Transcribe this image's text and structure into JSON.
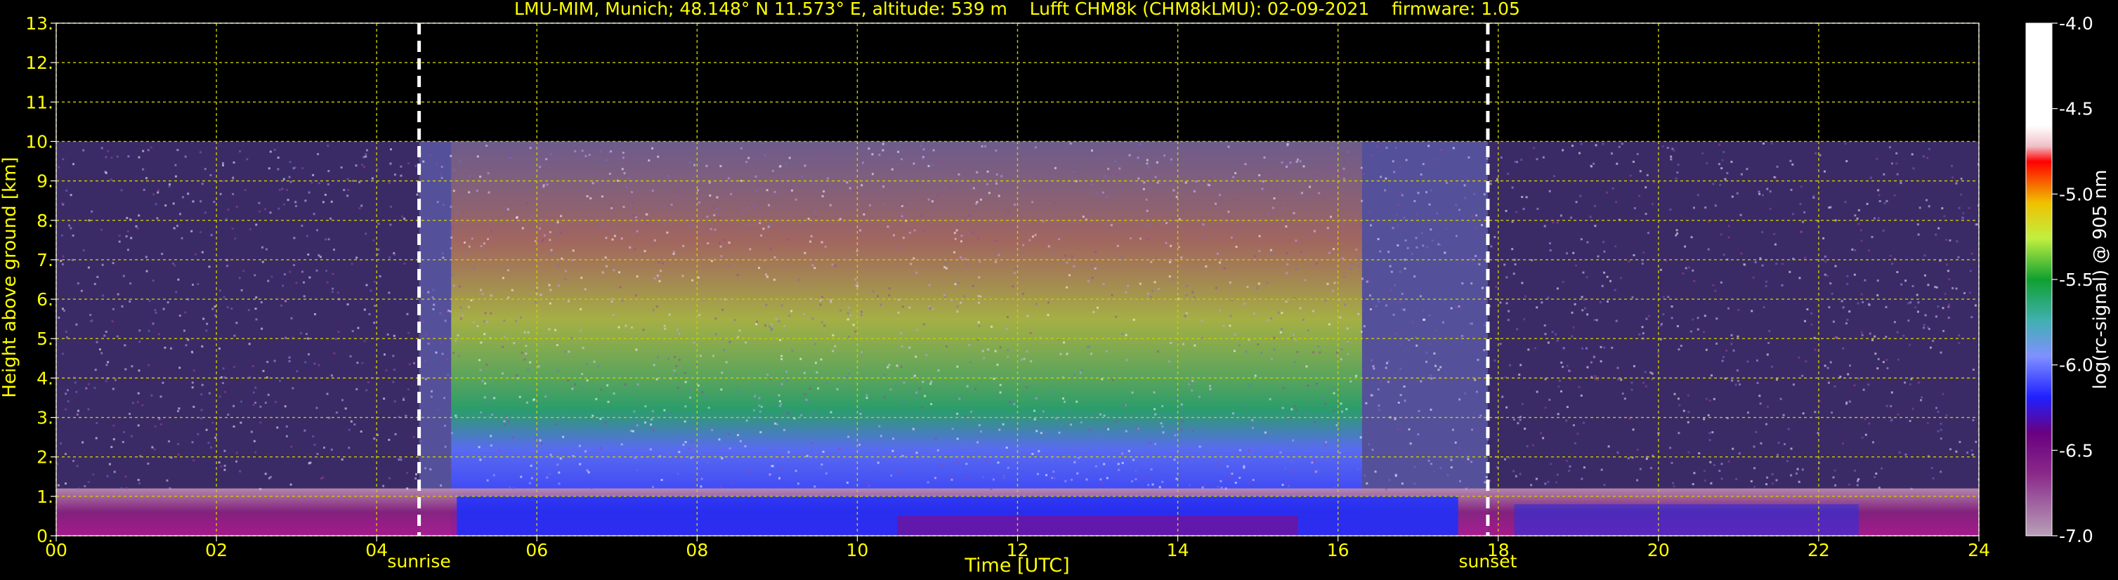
{
  "chart_data": {
    "type": "heatmap",
    "title": "LMU-MIM, Munich; 48.148° N 11.573° E, altitude: 539 m    Lufft CHM8k (CHM8kLMU): 02-09-2021    firmware: 1.05",
    "xlabel": "Time [UTC]",
    "ylabel": "Height above ground [km]",
    "xlim": [
      0,
      24
    ],
    "ylim": [
      0,
      13
    ],
    "x_ticks": [
      "00",
      "02",
      "04",
      "06",
      "08",
      "10",
      "12",
      "14",
      "16",
      "18",
      "20",
      "22",
      "24"
    ],
    "y_ticks": [
      "0.",
      "1.",
      "2.",
      "3.",
      "4.",
      "5.",
      "6.",
      "7.",
      "8.",
      "9.",
      "10.",
      "11.",
      "12.",
      "13."
    ],
    "x_tick_values": [
      0,
      2,
      4,
      6,
      8,
      10,
      12,
      14,
      16,
      18,
      20,
      22,
      24
    ],
    "y_tick_values": [
      0,
      1,
      2,
      3,
      4,
      5,
      6,
      7,
      8,
      9,
      10,
      11,
      12,
      13
    ],
    "grid": true,
    "data_top_km": 10,
    "markers": [
      {
        "label": "sunrise",
        "x": 4.53
      },
      {
        "label": "sunset",
        "x": 17.87
      }
    ],
    "colorbar": {
      "label": "log(rc-signal) @ 905 nm",
      "range": [
        -7.0,
        -4.0
      ],
      "ticks": [
        "-4.0",
        "-4.5",
        "-5.0",
        "-5.5",
        "-6.0",
        "-6.5",
        "-7.0"
      ],
      "tick_values": [
        -4.0,
        -4.5,
        -5.0,
        -5.5,
        -6.0,
        -6.5,
        -7.0
      ]
    },
    "colors": {
      "background": "#000000",
      "text": "#ffff00",
      "grid": "#cccc00",
      "marker": "#ffffff",
      "colorbar_text": "#ffffff"
    }
  }
}
